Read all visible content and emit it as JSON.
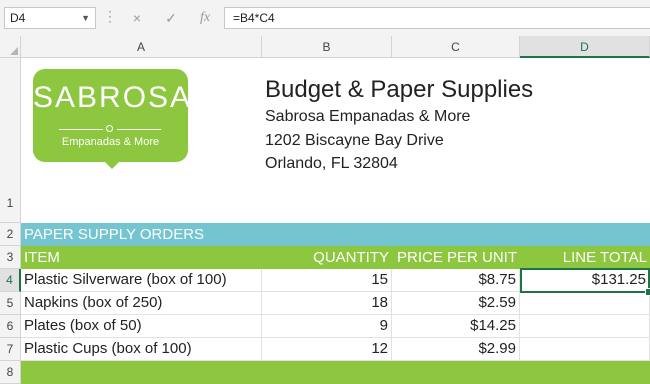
{
  "formula_bar": {
    "name_box": "D4",
    "cancel_icon": "×",
    "enter_icon": "✓",
    "function_icon": "fx",
    "formula": "=B4*C4"
  },
  "columns": [
    "A",
    "B",
    "C",
    "D"
  ],
  "selected_column": "D",
  "rows": [
    "1",
    "2",
    "3",
    "4",
    "5",
    "6",
    "7",
    "8"
  ],
  "selected_row": "4",
  "logo": {
    "title": "SABROSA",
    "subtitle": "Empanadas & More",
    "color": "#8dc63f"
  },
  "header": {
    "title": "Budget & Paper Supplies",
    "company": "Sabrosa Empanadas & More",
    "address": "1202 Biscayne Bay Drive",
    "city": "Orlando, FL 32804"
  },
  "section_title": "PAPER SUPPLY ORDERS",
  "table_headers": {
    "item": "ITEM",
    "quantity": "QUANTITY",
    "price": "PRICE PER UNIT",
    "line_total": "LINE TOTAL"
  },
  "items": [
    {
      "item": "Plastic Silverware (box of 100)",
      "quantity": "15",
      "price": "$8.75",
      "line_total": "$131.25"
    },
    {
      "item": "Napkins (box of 250)",
      "quantity": "18",
      "price": "$2.59",
      "line_total": ""
    },
    {
      "item": "Plates (box of 50)",
      "quantity": "9",
      "price": "$14.25",
      "line_total": ""
    },
    {
      "item": "Plastic Cups (box of 100)",
      "quantity": "12",
      "price": "$2.99",
      "line_total": ""
    }
  ],
  "colors": {
    "blue_band": "#74c5d0",
    "green_band": "#8dc63f",
    "selection": "#217346"
  }
}
